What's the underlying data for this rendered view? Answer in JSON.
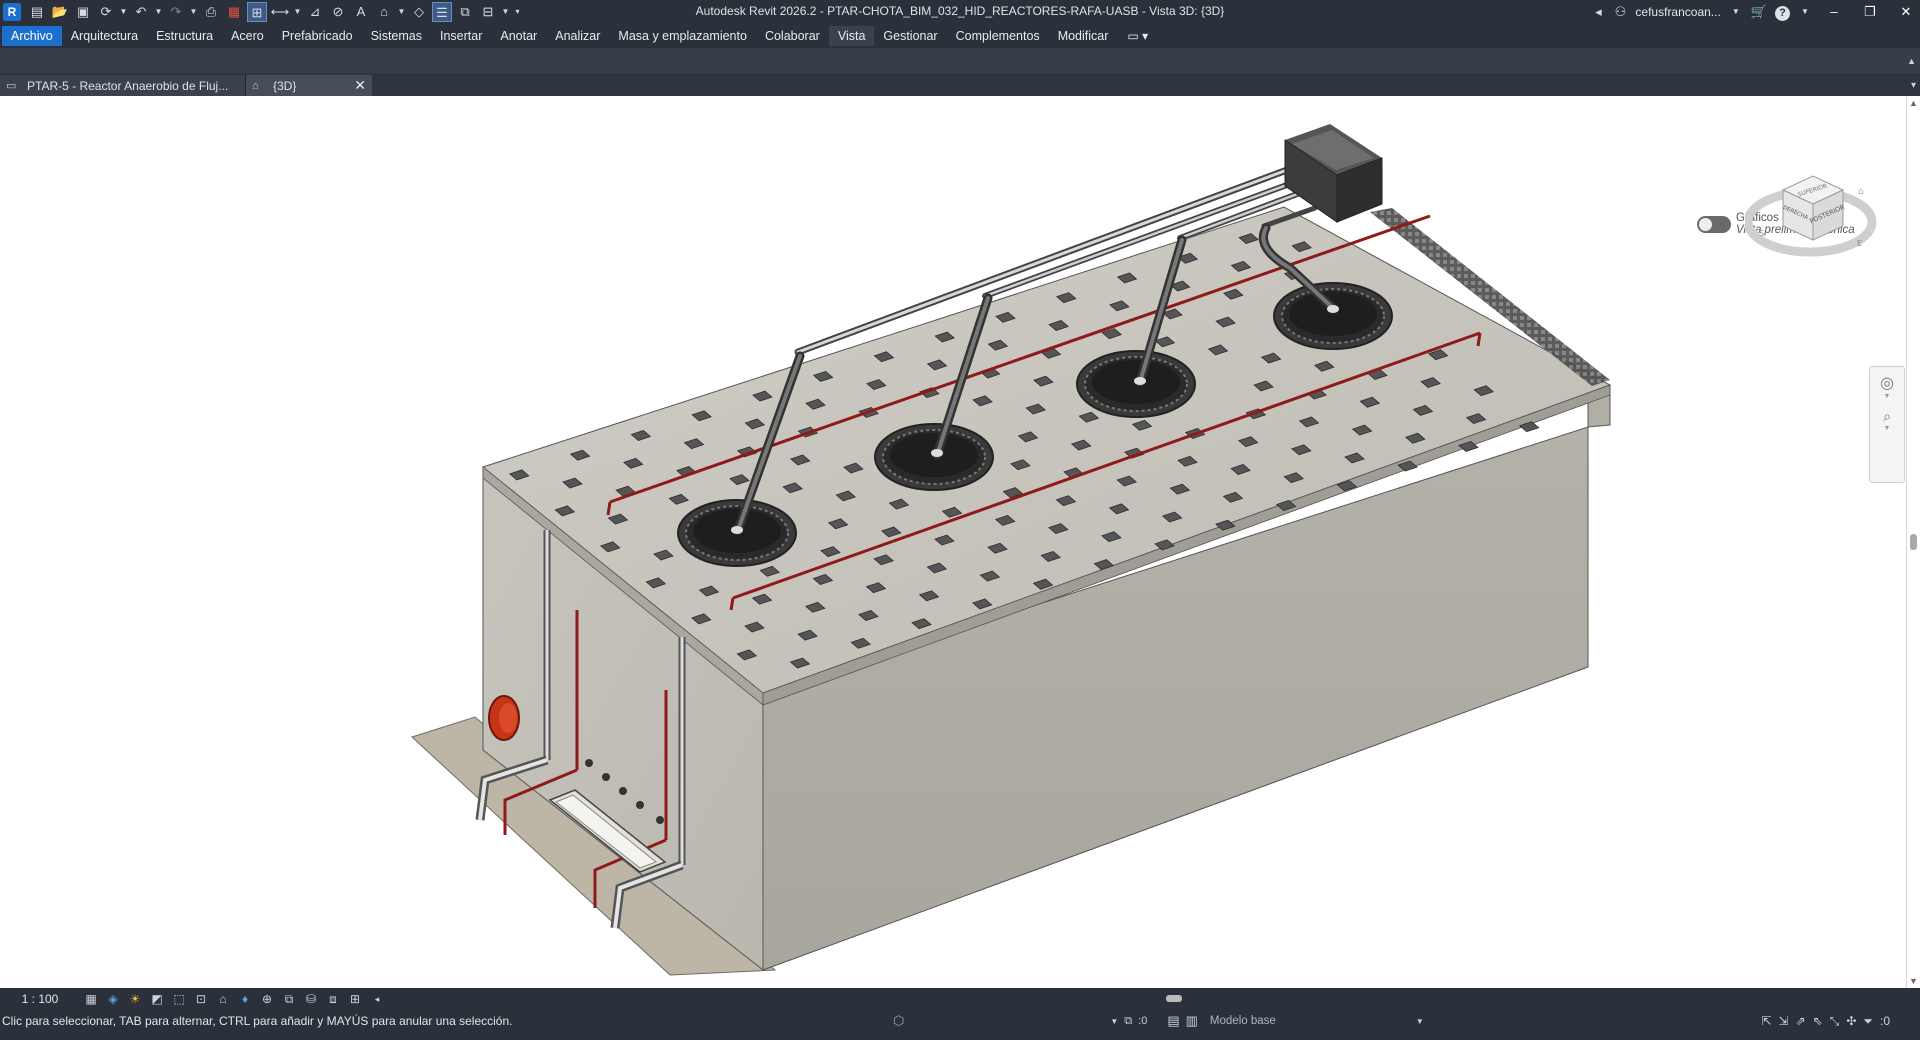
{
  "window": {
    "title": "Autodesk Revit 2026.2 - PTAR-CHOTA_BIM_032_HID_REACTORES-RAFA-UASB - Vista 3D: {3D}",
    "app_logo": "R",
    "user": "cefusfrancoan...",
    "help": "?"
  },
  "menu": {
    "tabs": [
      "Archivo",
      "Arquitectura",
      "Estructura",
      "Acero",
      "Prefabricado",
      "Sistemas",
      "Insertar",
      "Anotar",
      "Analizar",
      "Masa y emplazamiento",
      "Colaborar",
      "Vista",
      "Gestionar",
      "Complementos",
      "Modificar"
    ],
    "active": "Vista"
  },
  "view_tabs": [
    {
      "label": "PTAR-5 - Reactor Anaerobio de Fluj...",
      "icon": "plan-view-icon"
    },
    {
      "label": "{3D}",
      "icon": "home-3d-icon"
    }
  ],
  "viewport": {
    "graphics_label": "Gráficos acelerados",
    "graphics_sublabel": "Vista preliminar técnica",
    "viewcube": {
      "top": "SUPERIOR",
      "front": "POSTERIOR",
      "side": "DERECHA",
      "compass": [
        "S",
        "E"
      ]
    }
  },
  "view_control": {
    "scale": "1 : 100"
  },
  "status": {
    "message": "Clic para seleccionar, TAB para alternar, CTRL para añadir y MAYÚS para anular una selección.",
    "select_count": ":0",
    "model": "Modelo base",
    "filter_count": ":0"
  },
  "colors": {
    "chrome": "#2b313b",
    "file_tab": "#1d6fce",
    "concrete": "#c4c2b8",
    "pipe_red": "#a02020",
    "flange": "#d03020"
  }
}
